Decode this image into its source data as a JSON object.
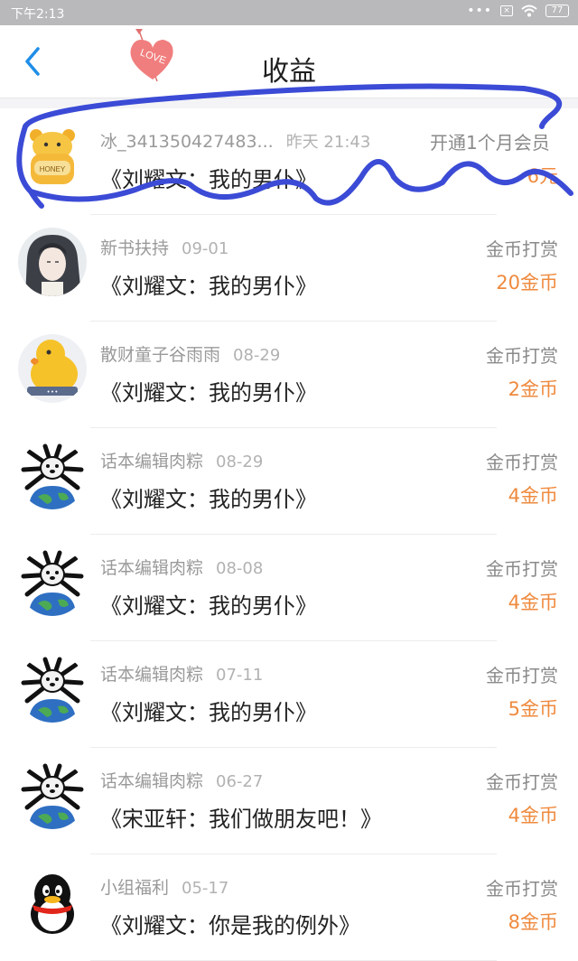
{
  "status_bar": {
    "time": "下午2:13",
    "battery": "77"
  },
  "header": {
    "title": "收益",
    "logo_text": "LOVE"
  },
  "records": [
    {
      "user": "冰_341350427483...",
      "date": "昨天 21:43",
      "type": "开通1个月会员",
      "book": "《刘耀文：我的男仆》",
      "amount": "6元",
      "avatar": "honey-pot"
    },
    {
      "user": "新书扶持",
      "date": "09-01",
      "type": "金币打赏",
      "book": "《刘耀文：我的男仆》",
      "amount": "20金币",
      "avatar": "anime-portrait"
    },
    {
      "user": "散财童子谷雨雨",
      "date": "08-29",
      "type": "金币打赏",
      "book": "《刘耀文：我的男仆》",
      "amount": "2金币",
      "avatar": "yellow-duck"
    },
    {
      "user": "话本编辑肉粽",
      "date": "08-29",
      "type": "金币打赏",
      "book": "《刘耀文：我的男仆》",
      "amount": "4金币",
      "avatar": "dog-earth"
    },
    {
      "user": "话本编辑肉粽",
      "date": "08-08",
      "type": "金币打赏",
      "book": "《刘耀文：我的男仆》",
      "amount": "4金币",
      "avatar": "dog-earth"
    },
    {
      "user": "话本编辑肉粽",
      "date": "07-11",
      "type": "金币打赏",
      "book": "《刘耀文：我的男仆》",
      "amount": "5金币",
      "avatar": "dog-earth"
    },
    {
      "user": "话本编辑肉粽",
      "date": "06-27",
      "type": "金币打赏",
      "book": "《宋亚轩：我们做朋友吧！》",
      "amount": "4金币",
      "avatar": "dog-earth"
    },
    {
      "user": "小组福利",
      "date": "05-17",
      "type": "金币打赏",
      "book": "《刘耀文：你是我的例外》",
      "amount": "8金币",
      "avatar": "qq-penguin"
    }
  ],
  "colors": {
    "accent": "#1e8ee8",
    "amount": "#ef8a3e",
    "scribble": "#3b4bd6"
  }
}
